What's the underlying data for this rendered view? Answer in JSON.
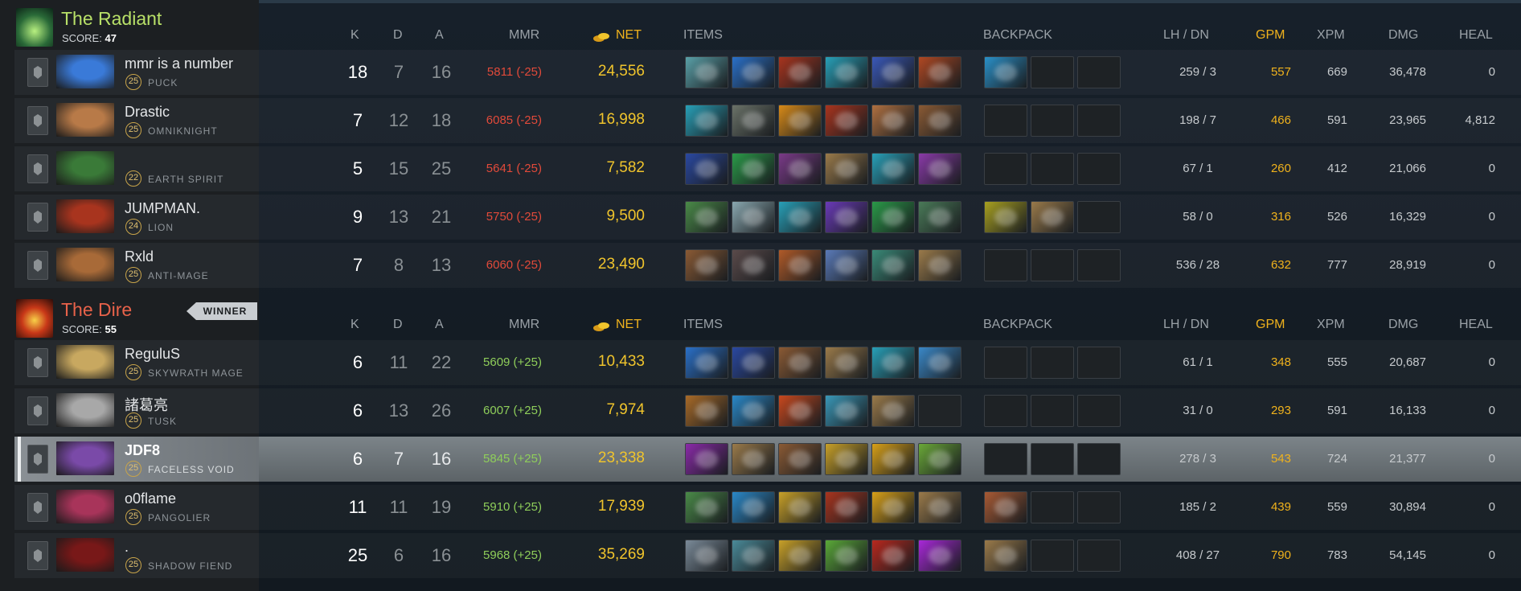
{
  "colors": {
    "radiant": "#b8e068",
    "dire": "#e8624a",
    "gold": "#f0c42c",
    "gpm": "#f0b21c",
    "mmr_loss": "#e24a3a",
    "mmr_gain": "#8fce5a"
  },
  "headers": {
    "k": "K",
    "d": "D",
    "a": "A",
    "mmr": "MMR",
    "net": "NET",
    "items": "ITEMS",
    "backpack": "BACKPACK",
    "lhdn": "LH  /  DN",
    "gpm": "GPM",
    "xpm": "XPM",
    "dmg": "DMG",
    "heal": "HEAL"
  },
  "radiant": {
    "name": "The Radiant",
    "score_label": "SCORE:",
    "score": "47",
    "players": [
      {
        "name": "mmr is a number",
        "level": "25",
        "hero": "PUCK",
        "k": "18",
        "d": "7",
        "a": "16",
        "mmr": "5811 (-25)",
        "net": "24,556",
        "lhdn": "259  /  3",
        "gpm": "557",
        "xpm": "669",
        "dmg": "36,478",
        "heal": "0",
        "items": [
          "#5aa0a8",
          "#2a70c8",
          "#a8341e",
          "#28a0b8",
          "#3a58b8",
          "#b04822"
        ],
        "backpack": [
          "#2a90c8",
          null,
          null
        ]
      },
      {
        "name": "Drastic",
        "level": "25",
        "hero": "OMNIKNIGHT",
        "k": "7",
        "d": "12",
        "a": "18",
        "mmr": "6085 (-25)",
        "net": "16,998",
        "lhdn": "198  /  7",
        "gpm": "466",
        "xpm": "591",
        "dmg": "23,965",
        "heal": "4,812",
        "items": [
          "#28a0b8",
          "#6a7268",
          "#d88a18",
          "#a8341e",
          "#b07040",
          "#8a5a34"
        ],
        "backpack": [
          null,
          null,
          null
        ]
      },
      {
        "name": "",
        "level": "22",
        "hero": "EARTH SPIRIT",
        "k": "5",
        "d": "15",
        "a": "25",
        "mmr": "5641 (-25)",
        "net": "7,582",
        "lhdn": "67  /  1",
        "gpm": "260",
        "xpm": "412",
        "dmg": "21,066",
        "heal": "0",
        "items": [
          "#2a48a0",
          "#2a9a48",
          "#7a3a88",
          "#9a7a4a",
          "#28a0b8",
          "#8a3aa8"
        ],
        "backpack": [
          null,
          null,
          null
        ]
      },
      {
        "name": "JUMPMAN.",
        "level": "24",
        "hero": "LION",
        "k": "9",
        "d": "13",
        "a": "21",
        "mmr": "5750 (-25)",
        "net": "9,500",
        "lhdn": "58  /  0",
        "gpm": "316",
        "xpm": "526",
        "dmg": "16,329",
        "heal": "0",
        "items": [
          "#4a8a48",
          "#8aa8b0",
          "#28a0b8",
          "#6a3ab8",
          "#2a9a48",
          "#4a7a58"
        ],
        "backpack": [
          "#a8a020",
          "#9a7a4a",
          null
        ]
      },
      {
        "name": "Rxld",
        "level": "25",
        "hero": "ANTI-MAGE",
        "k": "7",
        "d": "8",
        "a": "13",
        "mmr": "6060 (-25)",
        "net": "23,490",
        "lhdn": "536  /  28",
        "gpm": "632",
        "xpm": "777",
        "dmg": "28,919",
        "heal": "0",
        "items": [
          "#8a5a34",
          "#5a4a4a",
          "#b05a28",
          "#5a7ab8",
          "#3a8a78",
          "#9a7a4a"
        ],
        "backpack": [
          null,
          null,
          null
        ]
      }
    ]
  },
  "dire": {
    "name": "The Dire",
    "score_label": "SCORE:",
    "score": "55",
    "winner": "WINNER",
    "players": [
      {
        "name": "ReguluS",
        "level": "25",
        "hero": "SKYWRATH MAGE",
        "k": "6",
        "d": "11",
        "a": "22",
        "mmr": "5609 (+25)",
        "net": "10,433",
        "lhdn": "61  /  1",
        "gpm": "348",
        "xpm": "555",
        "dmg": "20,687",
        "heal": "0",
        "items": [
          "#2a70c8",
          "#2a48a0",
          "#8a5a34",
          "#9a7a4a",
          "#28a0b8",
          "#3a88c8"
        ],
        "backpack": [
          null,
          null,
          null
        ]
      },
      {
        "name": "諸葛亮",
        "level": "25",
        "hero": "TUSK",
        "k": "6",
        "d": "13",
        "a": "26",
        "mmr": "6007 (+25)",
        "net": "7,974",
        "lhdn": "31  /  0",
        "gpm": "293",
        "xpm": "591",
        "dmg": "16,133",
        "heal": "0",
        "items": [
          "#a86a28",
          "#2a88c8",
          "#c8481e",
          "#3a98b8",
          "#9a7a4a",
          null
        ],
        "backpack": [
          null,
          null,
          null
        ]
      },
      {
        "name": "JDF8",
        "level": "25",
        "hero": "FACELESS VOID",
        "k": "6",
        "d": "7",
        "a": "16",
        "mmr": "5845 (+25)",
        "net": "23,338",
        "lhdn": "278  /  3",
        "gpm": "543",
        "xpm": "724",
        "dmg": "21,377",
        "heal": "0",
        "selected": true,
        "items": [
          "#8a2aa8",
          "#9a7a4a",
          "#8a5a34",
          "#c8a028",
          "#d8a018",
          "#6aa838"
        ],
        "backpack": [
          null,
          null,
          null
        ]
      },
      {
        "name": "o0flame",
        "level": "25",
        "hero": "PANGOLIER",
        "k": "11",
        "d": "11",
        "a": "19",
        "mmr": "5910 (+25)",
        "net": "17,939",
        "lhdn": "185  /  2",
        "gpm": "439",
        "xpm": "559",
        "dmg": "30,894",
        "heal": "0",
        "items": [
          "#4a8a48",
          "#2a88c8",
          "#c8a028",
          "#a8341e",
          "#d8a018",
          "#9a7a4a"
        ],
        "backpack": [
          "#a85a34",
          null,
          null
        ]
      },
      {
        "name": ".",
        "level": "25",
        "hero": "SHADOW FIEND",
        "k": "25",
        "d": "6",
        "a": "16",
        "mmr": "5968 (+25)",
        "net": "35,269",
        "lhdn": "408  /  27",
        "gpm": "790",
        "xpm": "783",
        "dmg": "54,145",
        "heal": "0",
        "items": [
          "#7a8a98",
          "#4a8a98",
          "#c8a028",
          "#5aa838",
          "#b8281e",
          "#a828d8"
        ],
        "backpack": [
          "#9a7a4a",
          null,
          null
        ]
      }
    ]
  },
  "portraits": {
    "PUCK": "#3a7ad8",
    "OMNIKNIGHT": "#b87a48",
    "EARTH SPIRIT": "#3a7a38",
    "LION": "#a8341e",
    "ANTI-MAGE": "#a86a38",
    "SKYWRATH MAGE": "#c8a860",
    "TUSK": "#a8a8a8",
    "FACELESS VOID": "#7a4aa8",
    "PANGOLIER": "#a8345a",
    "SHADOW FIEND": "#781818"
  }
}
